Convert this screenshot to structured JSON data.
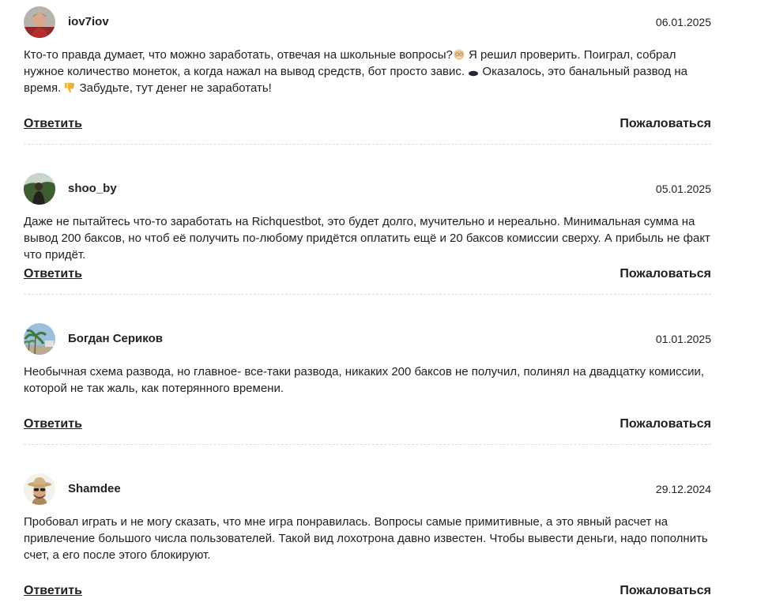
{
  "comments": [
    {
      "username": "iov7iov",
      "date": "06.01.2025",
      "text_parts": [
        "Кто-то правда думает, что можно заработать, отвечая на школьные вопросы?",
        " Я решил проверить. Поиграл, собрал нужное количество монеток, а когда нажал на вывод средств, бот просто завис. ",
        " Оказалось, это банальный развод на время. ",
        " Забудьте, тут денег не заработать!"
      ],
      "emojis": [
        "old-man-face-icon",
        "black-ellipse-icon",
        "thumbs-down-icon"
      ],
      "reply_label": "Ответить",
      "report_label": "Пожаловаться"
    },
    {
      "username": "shoo_by",
      "date": "05.01.2025",
      "text": "Даже не пытайтесь что-то заработать на Richquestbot, это будет долго, мучительно и нереально. Минимальная сумма на вывод 200 баксов, но чтоб её получить по-любому придётся оплатить ещё и 20 баксов комиссии сверху. А прибыль не факт что придёт.",
      "reply_label": "Ответить",
      "report_label": "Пожаловаться"
    },
    {
      "username": "Богдан Сериков",
      "date": "01.01.2025",
      "text": "Необычная схема развода, но главное- все-таки развода, никаких 200 баксов не получил, полинял на двадцатку комиссии, которой не так жаль, как потерянного времени.",
      "reply_label": "Ответить",
      "report_label": "Пожаловаться"
    },
    {
      "username": "Shamdee",
      "date": "29.12.2024",
      "text": "Пробовал играть и не могу сказать, что мне игра понравилась. Вопросы самые примитивные, а это явный расчет на привлечение большого числа пользователей. Такой вид лохотрона давно известен. Чтобы вывести деньги, надо пополнить счет, а его после этого блокируют.",
      "reply_label": "Ответить",
      "report_label": "Пожаловаться"
    }
  ]
}
